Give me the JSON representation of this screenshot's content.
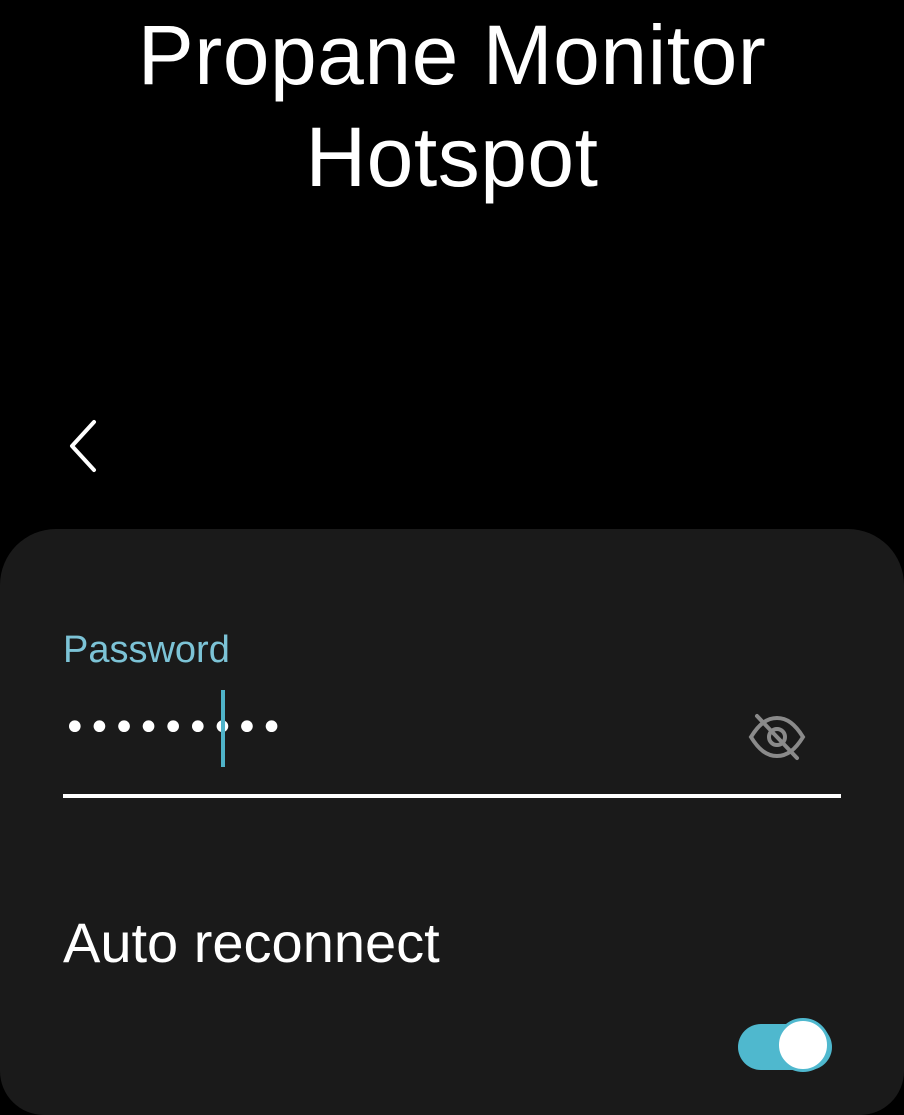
{
  "header": {
    "title_line1": "Propane Monitor",
    "title_line2": "Hotspot"
  },
  "navigation": {
    "back_icon": "chevron-left-icon"
  },
  "form": {
    "password_label": "Password",
    "password_value": "•••••••••",
    "visibility_icon": "eye-off-icon",
    "auto_reconnect_label": "Auto reconnect",
    "auto_reconnect_enabled": true
  },
  "colors": {
    "background": "#000000",
    "card": "#1a1a1a",
    "accent": "#4fb8ce",
    "label_accent": "#7cc3d6"
  }
}
